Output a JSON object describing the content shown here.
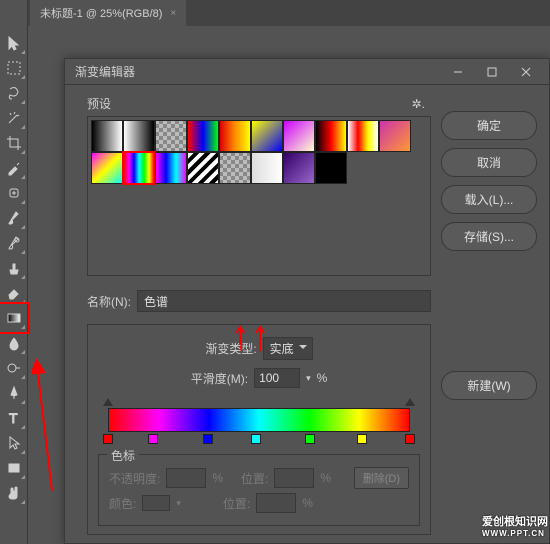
{
  "tab": {
    "title": "未标题-1 @ 25%(RGB/8)",
    "close": "×"
  },
  "dialog": {
    "title": "渐变编辑器",
    "buttons": {
      "ok": "确定",
      "cancel": "取消",
      "load": "载入(L)...",
      "save": "存储(S)...",
      "new": "新建(W)"
    },
    "presets_label": "预设",
    "name_label": "名称(N):",
    "name_value": "色谱",
    "type_label": "渐变类型:",
    "type_value": "实底",
    "smooth_label": "平滑度(M):",
    "smooth_value": "100",
    "percent": "%",
    "stops_label": "色标",
    "opacity_label": "不透明度:",
    "position_label": "位置:",
    "delete_label": "删除(D)",
    "color_label": "颜色:",
    "presets": [
      {
        "bg": "linear-gradient(90deg,#000,#fff)"
      },
      {
        "bg": "linear-gradient(90deg,#fff,#000)"
      },
      {
        "bg": "repeating-conic-gradient(#888 0 25%,#bbb 0 50%) 50%/8px 8px"
      },
      {
        "bg": "linear-gradient(90deg,#f00,#00f,#0f0)"
      },
      {
        "bg": "linear-gradient(90deg,#d00,#ff8c00,#ff0)"
      },
      {
        "bg": "linear-gradient(135deg,#ff0,#00f)"
      },
      {
        "bg": "linear-gradient(135deg,#c0f,#ffc)"
      },
      {
        "bg": "linear-gradient(90deg,#000,#f00,#ff0)"
      },
      {
        "bg": "linear-gradient(90deg,#fff,#f00,#ff0,#fff)"
      },
      {
        "bg": "linear-gradient(135deg,#c3a,#ff9933)"
      },
      {
        "bg": "linear-gradient(135deg,#f0f,#ff0,#0ff)"
      },
      {
        "bg": "linear-gradient(90deg,#f00,#f0f,#00f,#0ff,#0f0,#ff0,#f00)",
        "selected": true
      },
      {
        "bg": "linear-gradient(90deg,#f0f,#00f,#0ff,#f0f)"
      },
      {
        "bg": "repeating-linear-gradient(135deg,#fff 0 4px,#000 4px 8px)"
      },
      {
        "bg": "repeating-conic-gradient(#888 0 25%,#bbb 0 50%) 50%/8px 8px"
      },
      {
        "bg": "linear-gradient(90deg,#ddd,#fff)"
      },
      {
        "bg": "linear-gradient(135deg,#306,#96c)"
      },
      {
        "bg": "linear-gradient(90deg,#000,#000)"
      }
    ],
    "color_stops": [
      {
        "pos": 0,
        "color": "#ff0000"
      },
      {
        "pos": 15,
        "color": "#ff00ff"
      },
      {
        "pos": 33,
        "color": "#0000ff"
      },
      {
        "pos": 49,
        "color": "#00ffff"
      },
      {
        "pos": 67,
        "color": "#00ff00"
      },
      {
        "pos": 84,
        "color": "#ffff00"
      },
      {
        "pos": 100,
        "color": "#ff0000"
      }
    ]
  },
  "watermark": {
    "line1": "爱创根知识网",
    "line2": "WWW.PPT.CN"
  }
}
